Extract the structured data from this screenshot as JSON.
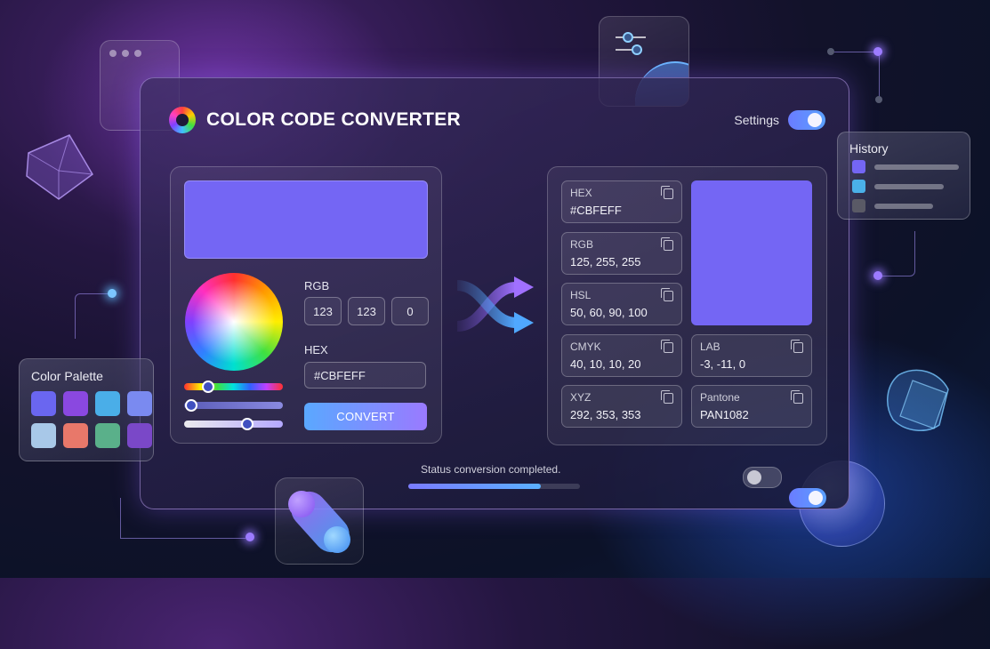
{
  "app": {
    "title": "COLOR CODE CONVERTER",
    "settings_label": "Settings"
  },
  "input": {
    "preview_color": "#7466f4",
    "rgb_label": "RGB",
    "rgb_values": [
      "123",
      "123",
      "0"
    ],
    "hex_label": "HEX",
    "hex_value": "#CBFEFF",
    "convert_label": "CONVERT"
  },
  "output": {
    "swatch_color": "#7466f4",
    "cards": [
      {
        "label": "HEX",
        "value": "#CBFEFF"
      },
      {
        "label": "RGB",
        "value": "125, 255, 255"
      },
      {
        "label": "HSL",
        "value": "50, 60, 90, 100"
      },
      {
        "label": "CMYK",
        "value": "40, 10, 10, 20"
      },
      {
        "label": "LAB",
        "value": "-3, -11, 0"
      },
      {
        "label": "XYZ",
        "value": "292, 353, 353"
      },
      {
        "label": "Pantone",
        "value": "PAN1082"
      }
    ]
  },
  "status": {
    "text": "Status conversion completed.",
    "progress": 0.77
  },
  "history": {
    "title": "History",
    "items": [
      {
        "color": "#7466f4"
      },
      {
        "color": "#4ab0e8"
      },
      {
        "color": "#5a5a66"
      }
    ]
  },
  "palette": {
    "title": "Color Palette",
    "colors": [
      "#6a66f0",
      "#8a48e0",
      "#4aaee8",
      "#7a8af0",
      "#a8c8e8",
      "#e8786a",
      "#5ab08a",
      "#7a48c8"
    ]
  },
  "colors": {
    "accent": "#7466f4",
    "convert_gradient": [
      "#5aa8ff",
      "#9a7aff"
    ]
  }
}
